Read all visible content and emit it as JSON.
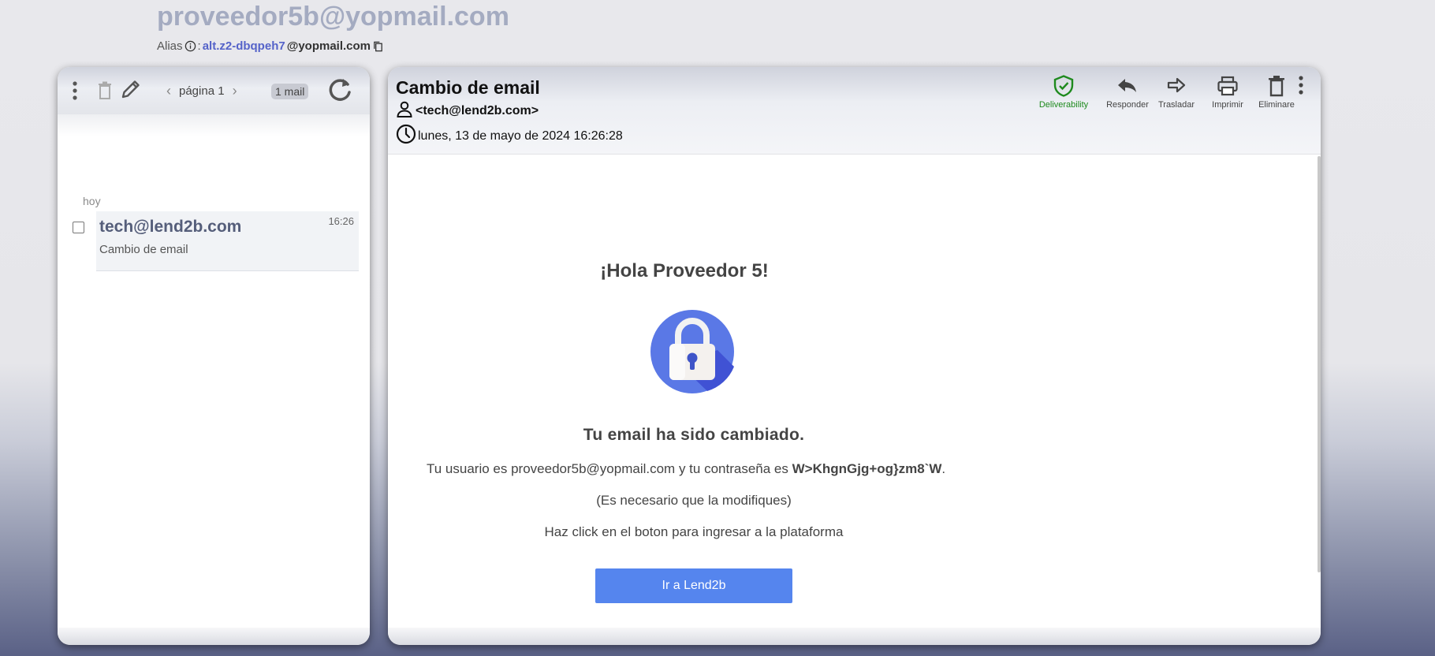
{
  "app": {
    "inbox_address": "proveedor5b@yopmail.com",
    "alias_label": "Alias",
    "alias_sep": ":",
    "alias_name": "alt.z2-dbqpeh7",
    "alias_domain": "@yopmail.com"
  },
  "mail_list": {
    "page_label": "página 1",
    "count_label": "1 mail",
    "day_group": "hoy",
    "items": [
      {
        "from": "tech@lend2b.com",
        "subject": "Cambio de email",
        "time": "16:26"
      }
    ]
  },
  "message": {
    "subject": "Cambio de email",
    "from": "<tech@lend2b.com>",
    "date": "lunes, 13 de mayo de 2024 16:26:28",
    "actions": {
      "deliverability": "Deliverability",
      "reply": "Responder",
      "forward": "Trasladar",
      "print": "Imprimir",
      "delete": "Eliminare"
    },
    "body": {
      "greeting": "¡Hola Proveedor 5!",
      "title": "Tu email ha sido cambiado.",
      "line1_prefix": "Tu usuario es proveedor5b@yopmail.com y tu contraseña es ",
      "password": "W>KhgnGjg+og}zm8`W",
      "line1_suffix": ".",
      "line2": "(Es necesario que la modifiques)",
      "line3": "Haz click en el boton para ingresar a la plataforma",
      "button": "Ir a Lend2b"
    }
  },
  "colors": {
    "accent": "#5585ee",
    "deliverability": "#1e8a1e",
    "alias": "#5563c9",
    "inbox_address": "#a4abc1"
  }
}
